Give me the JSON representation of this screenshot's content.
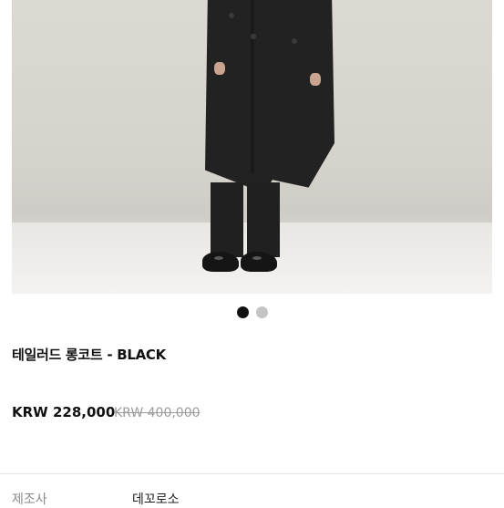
{
  "product": {
    "title": "테일러드 롱코트 - BLACK",
    "price": "KRW 228,000",
    "original_price": "KRW 400,000"
  },
  "gallery": {
    "total": 2,
    "active_index": 1
  },
  "specs": [
    {
      "label": "제조사",
      "value": "데꼬로소"
    }
  ],
  "colors": {
    "active_dot": "#111111",
    "inactive_dot": "#c4c4c4",
    "strike_price": "#9b9b9b"
  }
}
